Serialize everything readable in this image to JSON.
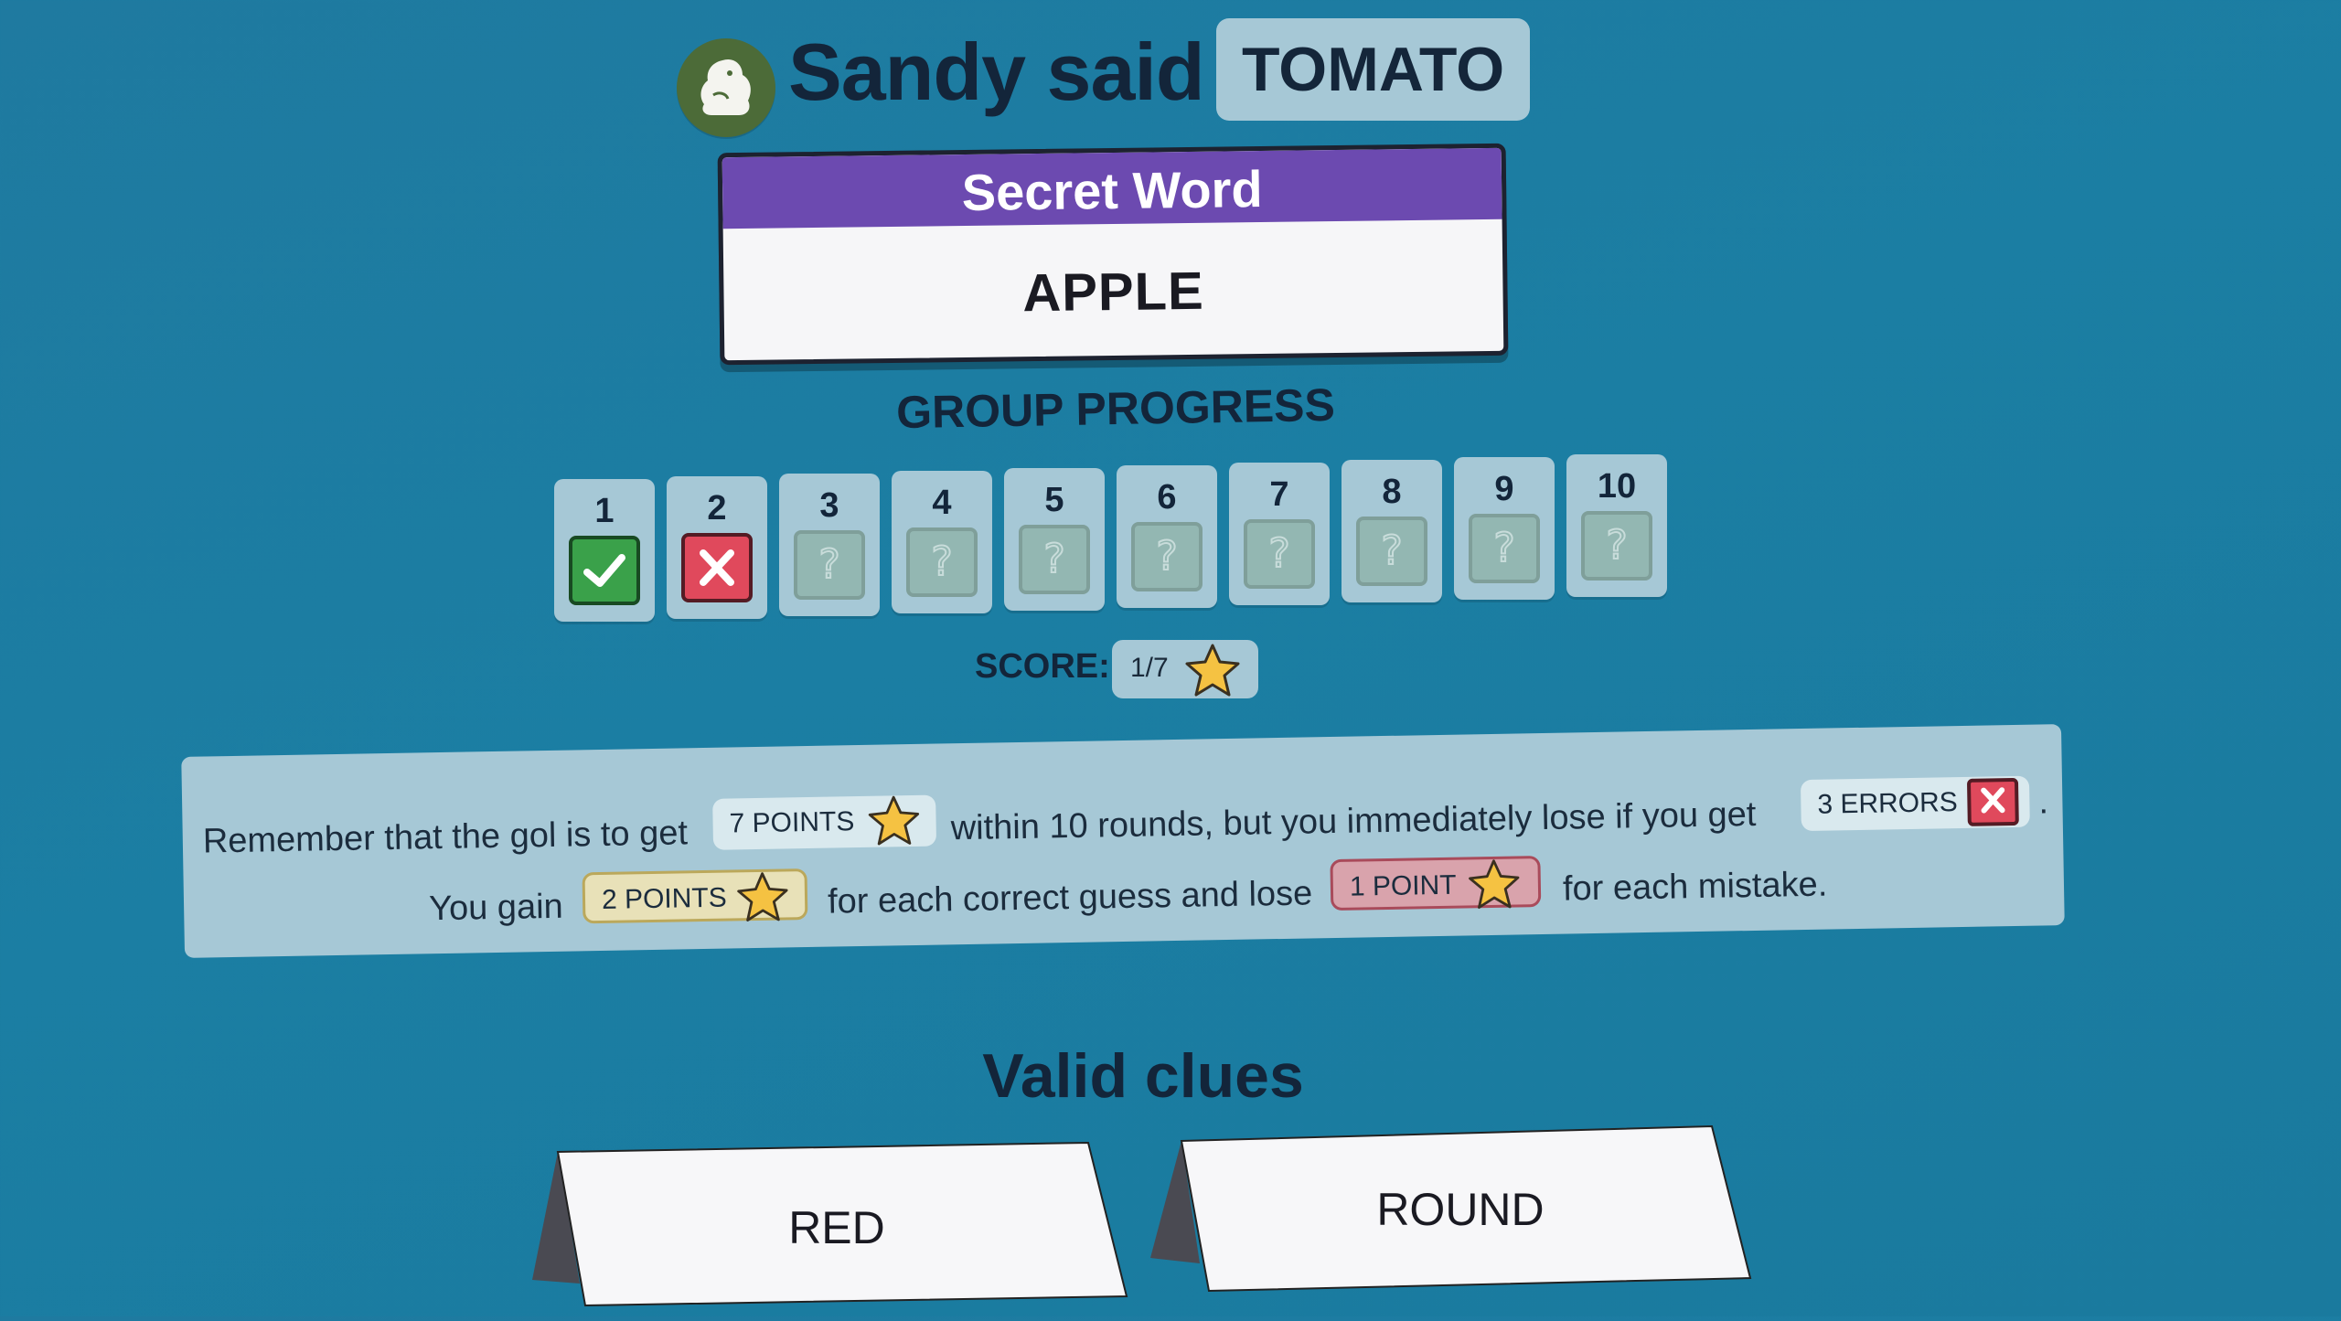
{
  "header": {
    "speaker_said": "Sandy said",
    "said_word": "TOMATO",
    "avatar_icon": "guinea-pig-icon"
  },
  "secret_word": {
    "title": "Secret Word",
    "value": "APPLE",
    "title_color": "#6c4ab0"
  },
  "progress": {
    "title": "GROUP PROGRESS",
    "rounds": [
      {
        "number": "1",
        "status": "correct"
      },
      {
        "number": "2",
        "status": "wrong"
      },
      {
        "number": "3",
        "status": "pending"
      },
      {
        "number": "4",
        "status": "pending"
      },
      {
        "number": "5",
        "status": "pending"
      },
      {
        "number": "6",
        "status": "pending"
      },
      {
        "number": "7",
        "status": "pending"
      },
      {
        "number": "8",
        "status": "pending"
      },
      {
        "number": "9",
        "status": "pending"
      },
      {
        "number": "10",
        "status": "pending"
      }
    ]
  },
  "score": {
    "label": "SCORE:",
    "value": "1/7"
  },
  "rules": {
    "line1_a": "Remember that the gol is to get",
    "points_goal": "7 POINTS",
    "line1_b": "within 10 rounds, but you immediately lose if you get",
    "errors_limit": "3 ERRORS",
    "line1_end": ".",
    "line2_a": "You gain",
    "gain_points": "2 POINTS",
    "line2_b": "for each correct guess and lose",
    "lose_points": "1 POINT",
    "line2_c": "for each mistake."
  },
  "clues": {
    "title": "Valid clues",
    "items": [
      "RED",
      "ROUND"
    ]
  },
  "colors": {
    "background": "#1b7ea3",
    "panel": "#a6c8d6",
    "correct": "#3aa14a",
    "wrong": "#e0495c",
    "star": "#f5c242"
  }
}
